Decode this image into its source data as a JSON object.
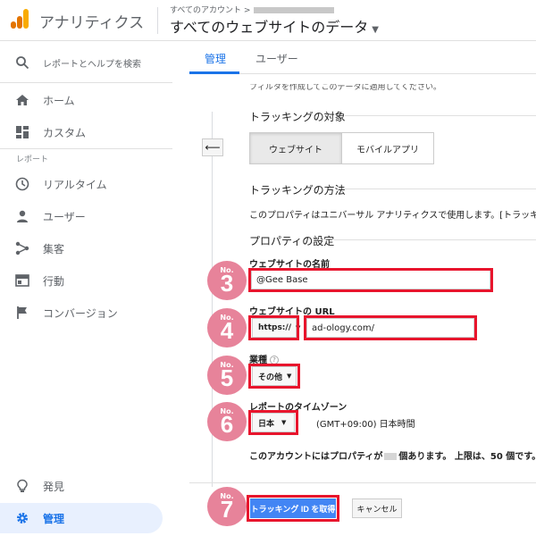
{
  "header": {
    "app_title": "アナリティクス",
    "breadcrumb": "すべてのアカウント >",
    "view_title": "すべてのウェブサイトのデータ",
    "brand_colors": {
      "bar1": "#f9ab00",
      "bar2": "#e37400",
      "bar3": "#e37400"
    }
  },
  "sidebar": {
    "search_label": "レポートとヘルプを検索",
    "items": [
      {
        "label": "ホーム",
        "icon": "home-icon"
      },
      {
        "label": "カスタム",
        "icon": "dashboard-icon"
      }
    ],
    "section_label": "レポート",
    "report_items": [
      {
        "label": "リアルタイム",
        "icon": "clock-icon"
      },
      {
        "label": "ユーザー",
        "icon": "person-icon"
      },
      {
        "label": "集客",
        "icon": "acquisition-icon"
      },
      {
        "label": "行動",
        "icon": "behavior-icon"
      },
      {
        "label": "コンバージョン",
        "icon": "flag-icon"
      }
    ],
    "bottom_items": [
      {
        "label": "発見",
        "icon": "lightbulb-icon"
      },
      {
        "label": "管理",
        "icon": "gear-icon"
      }
    ]
  },
  "tabs": [
    {
      "label": "管理",
      "active": true
    },
    {
      "label": "ユーザー",
      "active": false
    }
  ],
  "form": {
    "cut_text": "フィルタを作成してこのデータに適用してください。",
    "tracking_target_heading": "トラッキングの対象",
    "seg_website": "ウェブサイト",
    "seg_mobile": "モバイルアプリ",
    "tracking_method_heading": "トラッキングの方法",
    "tracking_method_text": "このプロパティはユニバーサル アナリティクスで使用します。[トラッキ",
    "property_settings_heading": "プロパティの設定",
    "site_name_label": "ウェブサイトの名前",
    "site_name_value": "@Gee Base",
    "site_url_label": "ウェブサイトの URL",
    "protocol_value": "https://",
    "url_value": "ad-ology.com/",
    "industry_label": "業種",
    "industry_value": "その他",
    "timezone_label": "レポートのタイムゾーン",
    "timezone_country": "日本",
    "timezone_value": "(GMT+09:00) 日本時間",
    "account_note_pre": "このアカウントにはプロパティが",
    "account_note_post": "個あります。 上限は、50 個です。",
    "submit_label": "トラッキング ID を取得",
    "cancel_label": "キャンセル"
  },
  "badges": [
    {
      "no": "No.",
      "num": "3"
    },
    {
      "no": "No.",
      "num": "4"
    },
    {
      "no": "No.",
      "num": "5"
    },
    {
      "no": "No.",
      "num": "6"
    },
    {
      "no": "No.",
      "num": "7"
    }
  ]
}
